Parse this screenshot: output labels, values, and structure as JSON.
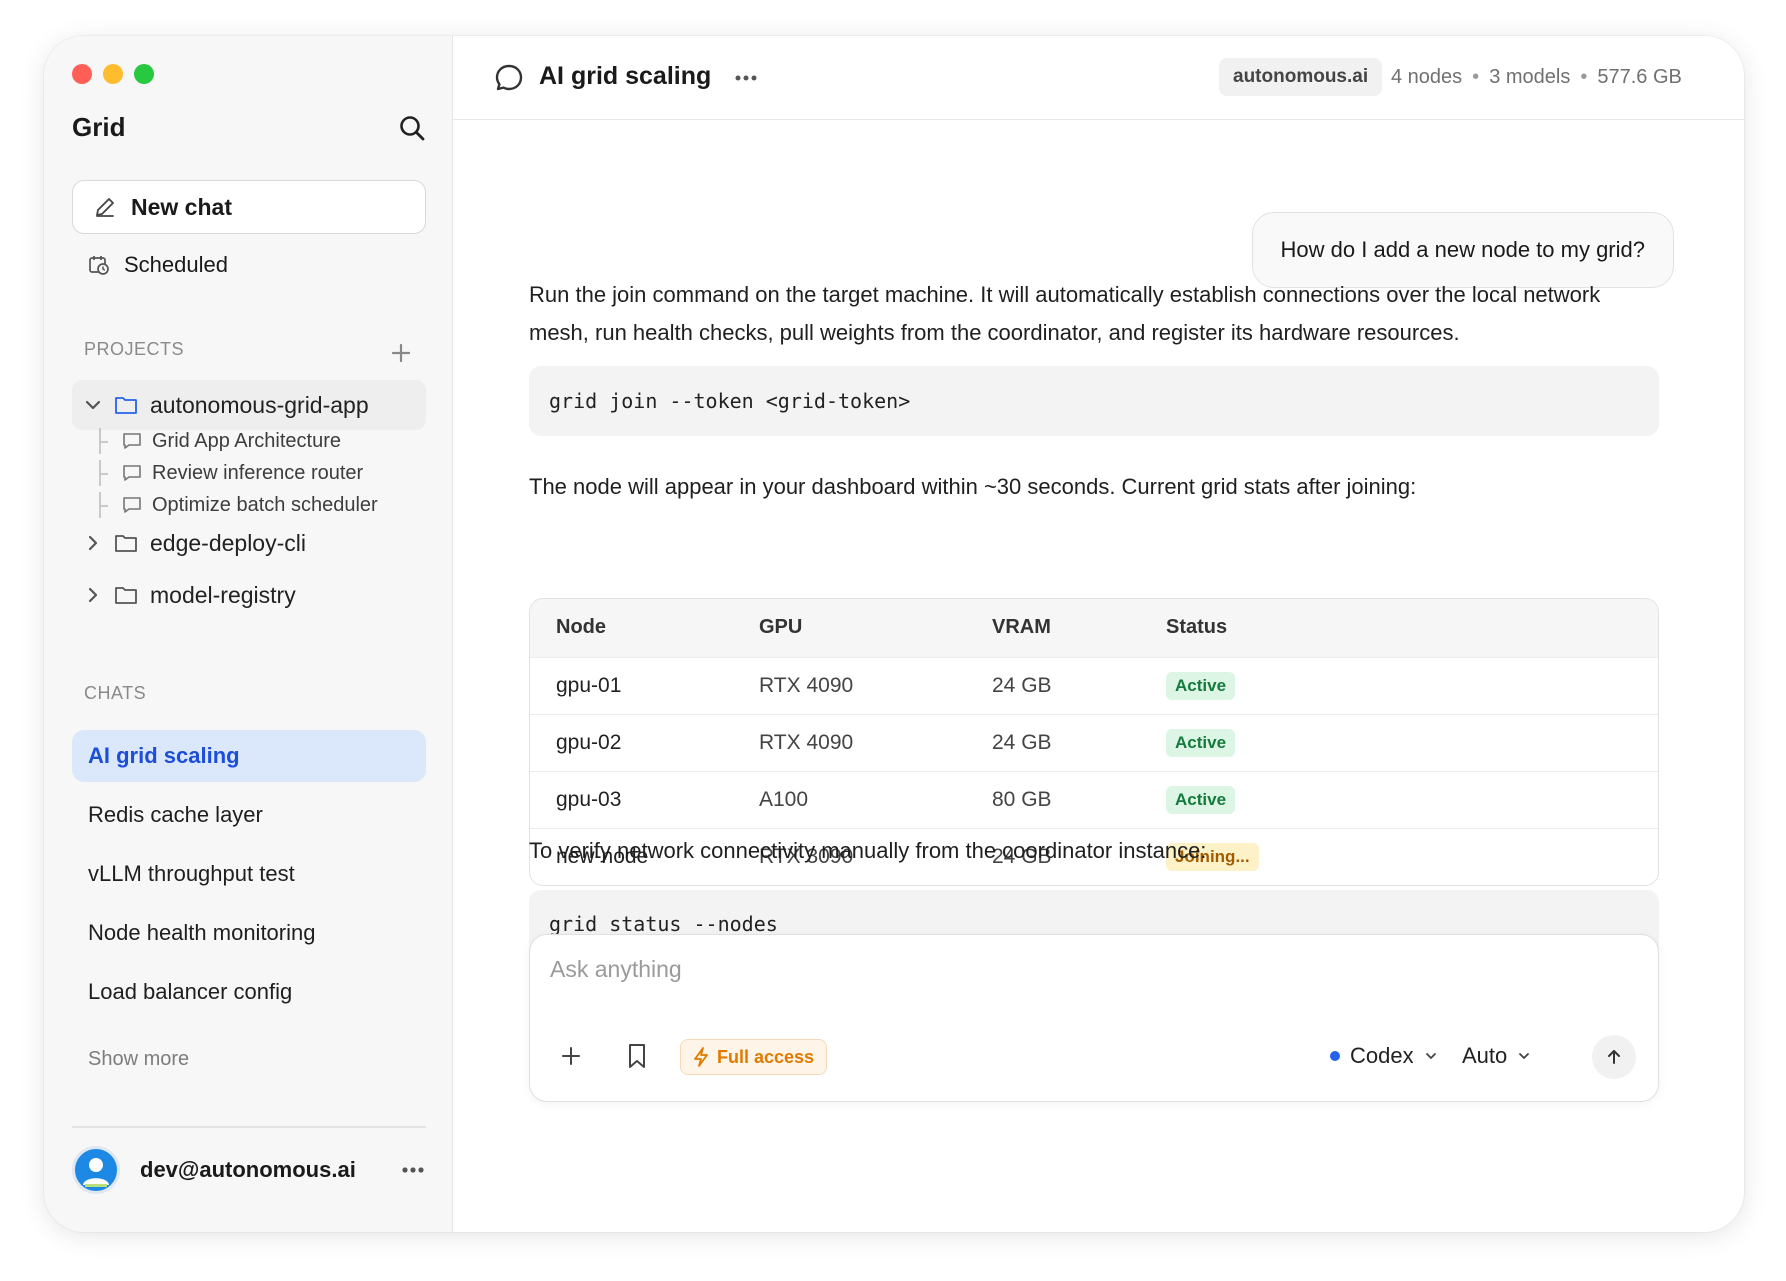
{
  "sidebar": {
    "app_title": "Grid",
    "new_chat_label": "New chat",
    "scheduled_label": "Scheduled",
    "projects_label": "PROJECTS",
    "projects": [
      {
        "name": "autonomous-grid-app",
        "expanded": true,
        "chats": [
          "Grid App Architecture",
          "Review inference router",
          "Optimize batch scheduler"
        ]
      },
      {
        "name": "edge-deploy-cli",
        "expanded": false
      },
      {
        "name": "model-registry",
        "expanded": false
      }
    ],
    "chats_label": "CHATS",
    "chats": [
      "AI grid scaling",
      "Redis cache layer",
      "vLLM throughput test",
      "Node health monitoring",
      "Load balancer config"
    ],
    "active_chat": "AI grid scaling",
    "show_more_label": "Show more",
    "user_email": "dev@autonomous.ai"
  },
  "header": {
    "title": "AI grid scaling",
    "domain_badge": "autonomous.ai",
    "stats": [
      "4 nodes",
      "3 models",
      "577.6 GB"
    ]
  },
  "conversation": {
    "user_message": "How do I add a new node to my grid?",
    "reply_intro": "Run the join command on the target machine. It will automatically establish connections over the local network mesh, run health checks, pull weights from the coordinator, and register its hardware resources.",
    "code_1": "grid join --token <grid-token>",
    "reply_middle": "The node will appear in your dashboard within ~30 seconds. Current grid stats after joining:",
    "table": {
      "headers": [
        "Node",
        "GPU",
        "VRAM",
        "Status"
      ],
      "rows": [
        {
          "node": "gpu-01",
          "gpu": "RTX 4090",
          "vram": "24 GB",
          "status": "Active"
        },
        {
          "node": "gpu-02",
          "gpu": "RTX 4090",
          "vram": "24 GB",
          "status": "Active"
        },
        {
          "node": "gpu-03",
          "gpu": "A100",
          "vram": "80 GB",
          "status": "Active"
        },
        {
          "node": "new-node",
          "gpu": "RTX 3090",
          "vram": "24 GB",
          "status": "Joining..."
        }
      ]
    },
    "reply_outro": "To verify network connectivity manually from the coordinator instance:",
    "code_2": "grid status --nodes"
  },
  "composer": {
    "placeholder": "Ask anything",
    "access_label": "Full access",
    "model_label": "Codex",
    "mode_label": "Auto"
  },
  "colors": {
    "accent": "#1d4ed8",
    "active_chat_bg": "#dbe8fb",
    "status_active_bg": "#dcf5e4",
    "status_active_text": "#157a3d",
    "status_joining_bg": "#fdf1c8",
    "status_joining_text": "#a35b00",
    "access_text": "#e07b00"
  }
}
